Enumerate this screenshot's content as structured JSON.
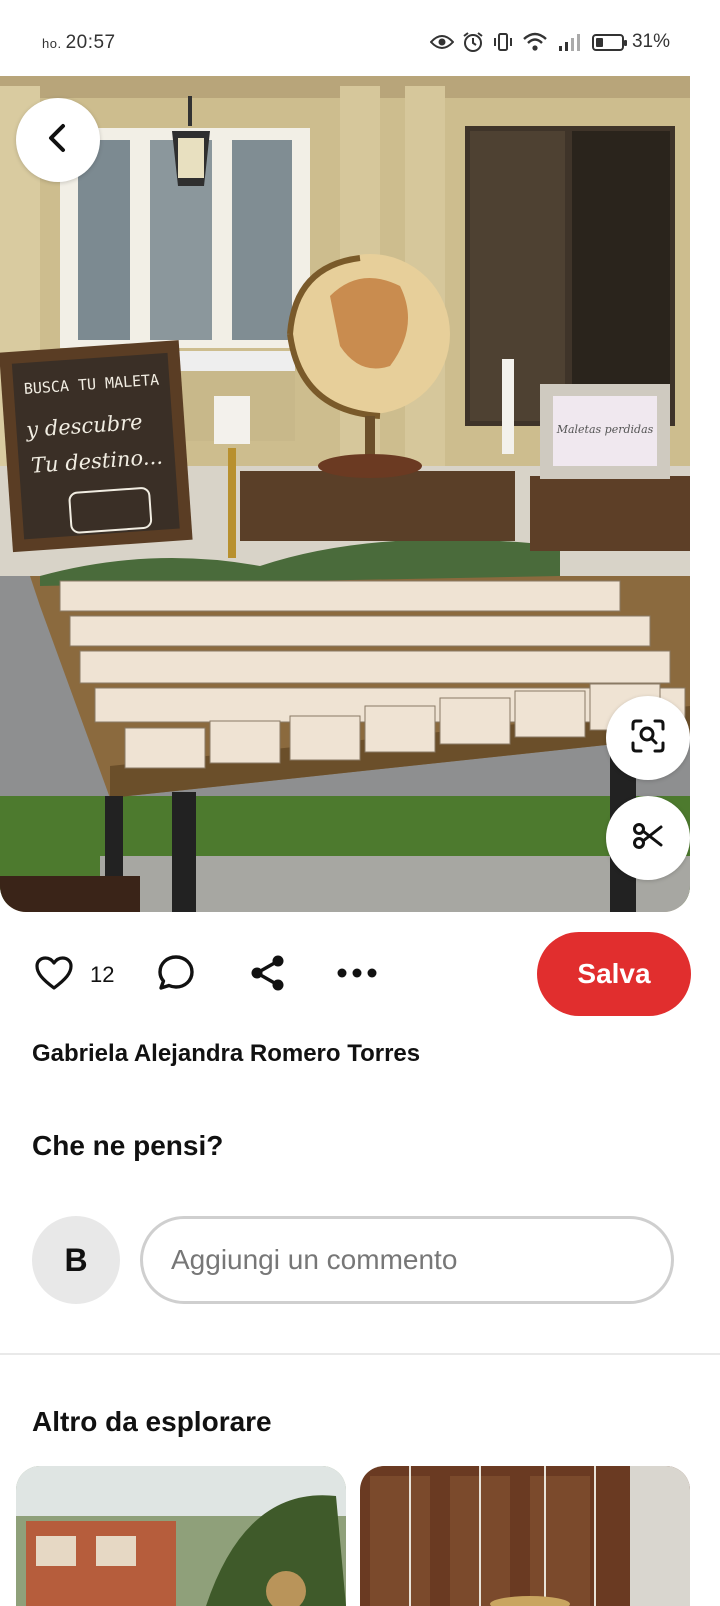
{
  "status_bar": {
    "time_prefix": "ho.",
    "time": "20:57",
    "battery": "31%",
    "battery_level": 0.31,
    "icons": [
      "eye-icon",
      "alarm-icon",
      "vibrate-icon",
      "wifi-icon",
      "signal-icon",
      "battery-icon"
    ]
  },
  "pin": {
    "image_sign": {
      "line1": "BUSCA TU MALETA",
      "line2": "y descubre",
      "line3": "Tu destino..."
    },
    "image_frame": "Maletas perdidas",
    "buttons": [
      "back-icon",
      "visual-search-icon",
      "scissors-icon"
    ]
  },
  "actions": {
    "like_count": "12",
    "save_label": "Salva",
    "icons": [
      "heart-icon",
      "comment-icon",
      "share-icon",
      "more-icon"
    ]
  },
  "author": "Gabriela Alejandra Romero Torres",
  "comments": {
    "heading": "Che ne pensi?",
    "avatar_initial": "B",
    "placeholder": "Aggiungi un commento"
  },
  "explore": {
    "heading": "Altro da esplorare"
  },
  "colors": {
    "save_button": "#e12e2e",
    "text": "#111111",
    "input_border": "#cfcfcf"
  }
}
